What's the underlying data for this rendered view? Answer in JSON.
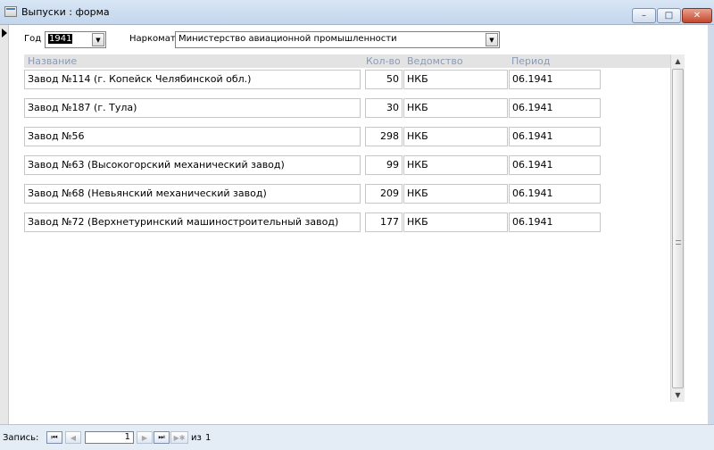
{
  "window": {
    "title": "Выпуски : форма",
    "minimize_glyph": "–",
    "maximize_glyph": "□",
    "close_glyph": "✕"
  },
  "filters": {
    "year_label": "Год",
    "year_value": "1941",
    "commissariat_label": "Наркомат",
    "commissariat_value": "Министерство авиационной промышленности",
    "dropdown_glyph": "▼"
  },
  "columns": [
    "Название",
    "Кол-во",
    "Ведомство",
    "Период"
  ],
  "rows": [
    {
      "name": "Завод №114 (г. Копейск Челябинской обл.)",
      "qty": "50",
      "dept": "НКБ",
      "period": "06.1941"
    },
    {
      "name": "Завод №187 (г. Тула)",
      "qty": "30",
      "dept": "НКБ",
      "period": "06.1941"
    },
    {
      "name": "Завод №56",
      "qty": "298",
      "dept": "НКБ",
      "period": "06.1941"
    },
    {
      "name": "Завод №63 (Высокогорский механический завод)",
      "qty": "99",
      "dept": "НКБ",
      "period": "06.1941"
    },
    {
      "name": "Завод №68 (Невьянский механический завод)",
      "qty": "209",
      "dept": "НКБ",
      "period": "06.1941"
    },
    {
      "name": "Завод №72 (Верхнетуринский машиностроительный завод)",
      "qty": "177",
      "dept": "НКБ",
      "period": "06.1941"
    }
  ],
  "scrollbar": {
    "up_glyph": "▲",
    "down_glyph": "▼"
  },
  "nav": {
    "label": "Запись:",
    "first_glyph": "⏮",
    "prev_glyph": "◀",
    "current": "1",
    "next_glyph": "▶",
    "last_glyph": "⏭",
    "new_glyph": "▶✱",
    "of_label": "из",
    "total": "1"
  },
  "colors": {
    "titlebar": "#c9dbef",
    "column_header_text": "#8a9bb6",
    "column_header_band": "#e3e3e3",
    "navbar": "#e4ecf5"
  },
  "icons": [
    "form-icon",
    "record-selector-arrow-icon",
    "dropdown-arrow-icon",
    "scroll-up-icon",
    "scroll-down-icon",
    "first-record-icon",
    "prev-record-icon",
    "next-record-icon",
    "last-record-icon",
    "new-record-icon"
  ]
}
